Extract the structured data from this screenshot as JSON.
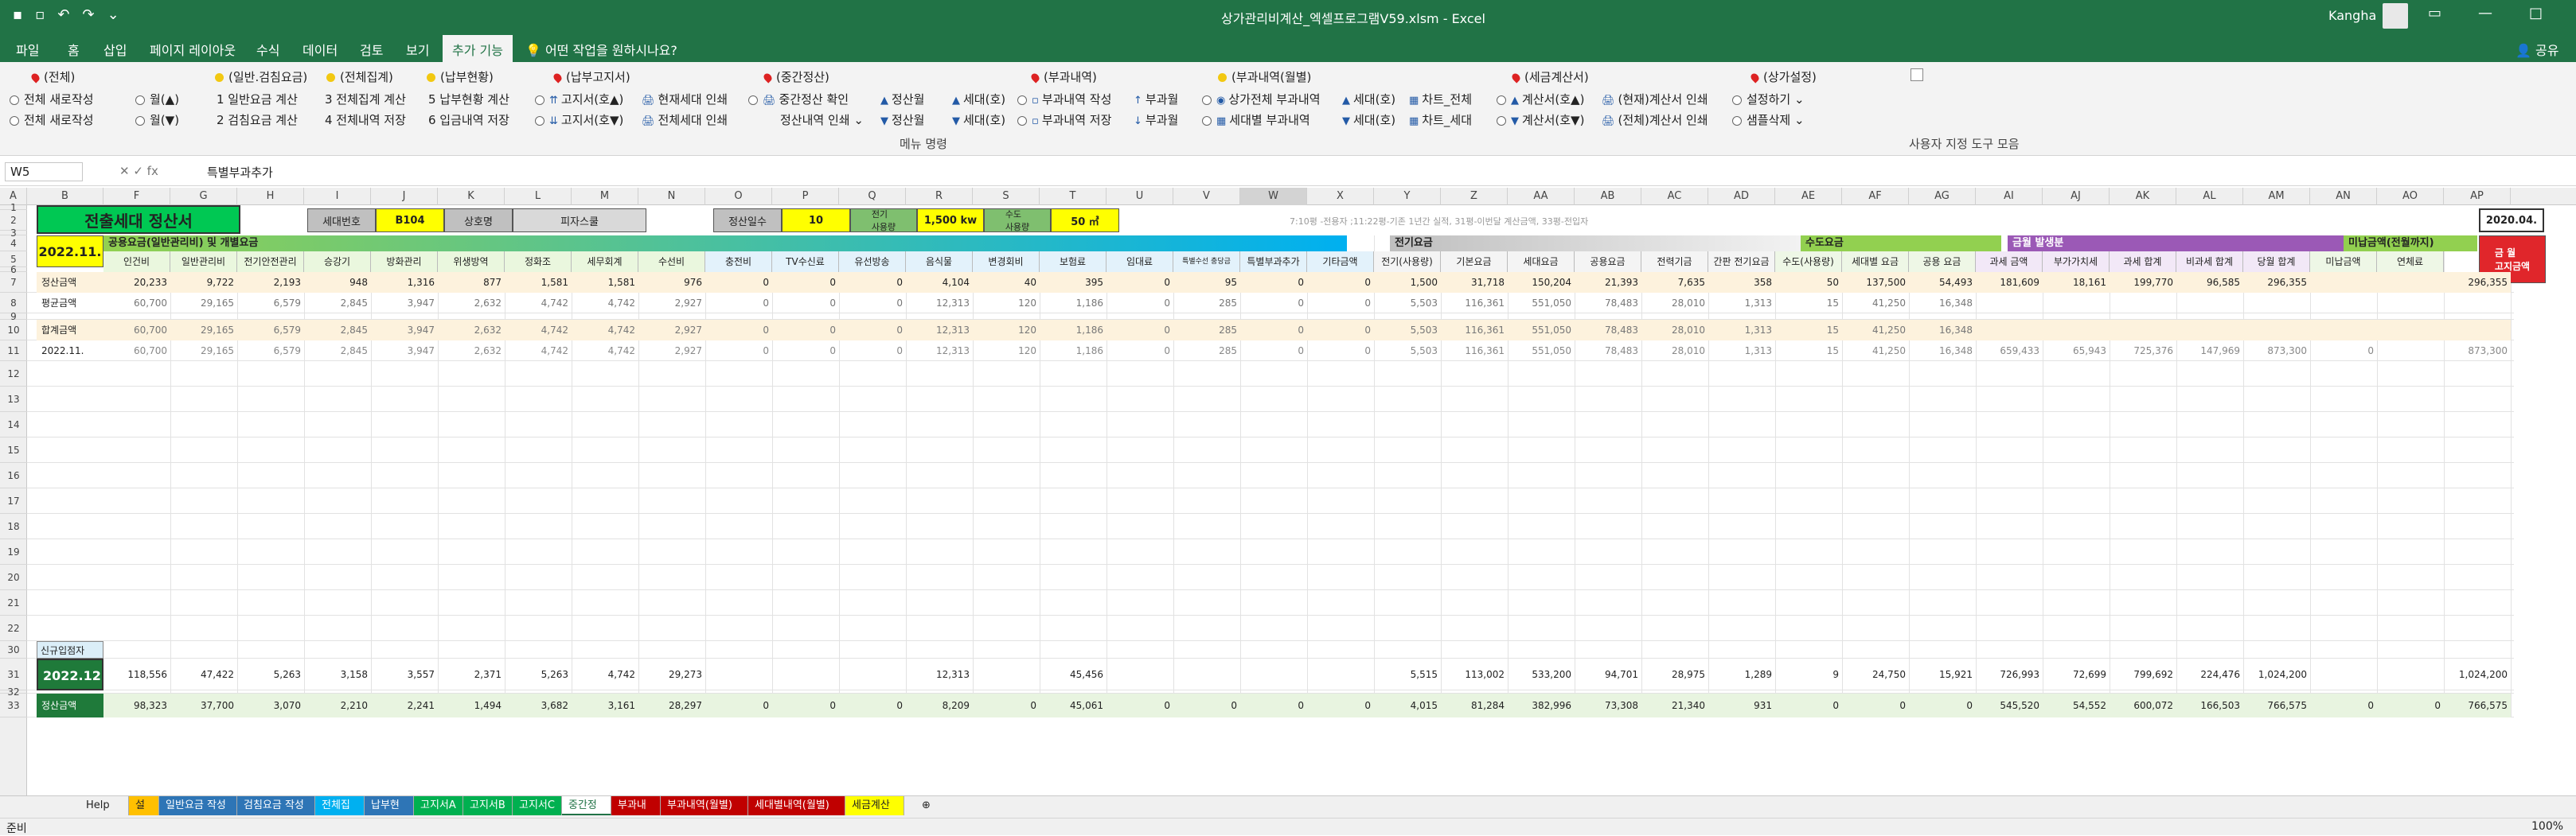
{
  "titlebar": {
    "title": "상가관리비계산_엑셀프로그램V59.xlsm  -  Excel",
    "user": "Kangha"
  },
  "tabs": [
    "파일",
    "홈",
    "삽입",
    "페이지 레이아웃",
    "수식",
    "데이터",
    "검토",
    "보기",
    "추가 기능"
  ],
  "active_tab": "추가 기능",
  "tell_me": "어떤 작업을 원하시나요?",
  "share": "공유",
  "ribbon": {
    "headers": [
      "(전체)",
      "(일반.검침요금)",
      "(전체집계)",
      "(납부현황)",
      "(납부고지서)",
      "(중간정산)",
      "(부과내역)",
      "(부과내역(월별)",
      "(세금계산서)",
      "(상가설정)"
    ],
    "row1": [
      "전체 새로작성",
      "월(▲)",
      "1 일반요금 계산",
      "3 전체집계 계산",
      "5 납부현황 계산",
      "고지서(호▲)",
      "현재세대 인쇄",
      "중간정산 확인",
      "정산월",
      "세대(호)",
      "부과내역 작성",
      "부과월",
      "상가전체 부과내역",
      "세대(호)",
      "차트_전체",
      "계산서(호▲)",
      "(현재)계산서 인쇄",
      "설정하기"
    ],
    "row2": [
      "전체 새로작성",
      "월(▼)",
      "2 검침요금 계산",
      "4 전체내역 저장",
      "6 입금내역 저장",
      "고지서(호▼)",
      "전체세대 인쇄",
      "정산내역 인쇄",
      "정산월",
      "세대(호)",
      "부과내역 저장",
      "부과월",
      "세대별 부과내역",
      "세대(호)",
      "차트_세대",
      "계산서(호▼)",
      "(전체)계산서 인쇄",
      "샘플삭제"
    ],
    "group_label": "메뉴 명령",
    "custom_label": "사용자 지정 도구 모음"
  },
  "namebox": "W5",
  "formula": "특별부과추가",
  "columns": [
    "A",
    "B",
    "F",
    "G",
    "H",
    "I",
    "J",
    "K",
    "L",
    "M",
    "N",
    "O",
    "P",
    "Q",
    "R",
    "S",
    "T",
    "U",
    "V",
    "W",
    "X",
    "Y",
    "Z",
    "AA",
    "AB",
    "AC",
    "AD",
    "AE",
    "AF",
    "AG",
    "AI",
    "AJ",
    "AK",
    "AL",
    "AM",
    "AN",
    "AO",
    "AP"
  ],
  "selected_column": "W",
  "rows": [
    "1",
    "2",
    "3",
    "4",
    "5",
    "6",
    "7",
    "8",
    "9",
    "10",
    "11",
    "12",
    "13",
    "14",
    "15",
    "16",
    "17",
    "18",
    "19",
    "20",
    "21",
    "22",
    "30",
    "31",
    "32",
    "33"
  ],
  "title_box": "전출세대 정산서",
  "info": {
    "unit_label": "세대번호",
    "unit": "B104",
    "name_label": "상호명",
    "name": "피자스쿨",
    "days_label": "정산일수",
    "days": "10",
    "elec_label": "전기\n사용량",
    "elec": "1,500 kw",
    "water_label": "수도\n사용량",
    "water": "50 ㎥",
    "note": "7:10평 -전용자 ;11:22평-기존 1년간 실적, 31평-이번달 계산금액, 33평-전입자",
    "date": "2020.04."
  },
  "month_label": "2022.11.",
  "sections": {
    "common": "공용요금(일반관리비) 및 개별요금",
    "elec": "전기요금",
    "water": "수도요금",
    "billing": "금월 발생분",
    "unpaid": "미납금액(전월까지)",
    "notice": "금 월\n고지금액"
  },
  "headers": [
    "인건비",
    "일반관리비",
    "전기안전관리",
    "승강기",
    "방화관리",
    "위생방역",
    "정화조",
    "세무회계",
    "수선비",
    "충전비",
    "TV수신료",
    "유선방송",
    "음식물",
    "변경회비",
    "보험료",
    "임대료",
    "특별수선 충당금",
    "특별부과추가",
    "기타금액",
    "전기(사용량)",
    "기본요금",
    "세대요금",
    "공용요금",
    "전력기금",
    "간판 전기요금",
    "수도(사용량)",
    "세대별 요금",
    "공용 요금",
    "과세 금액",
    "부가가치세",
    "과세 합계",
    "비과세 합계",
    "당월 합계",
    "미납금액",
    "연체료",
    ""
  ],
  "row_labels": {
    "r7": "정산금액",
    "r8": "평균금액",
    "r10": "합계금액",
    "r11": "2022.11.",
    "r30": "신규입점자",
    "r31": "2022.12.",
    "r33": "정산금액"
  },
  "data": {
    "r7": [
      "20,233",
      "9,722",
      "2,193",
      "948",
      "1,316",
      "877",
      "1,581",
      "1,581",
      "976",
      "0",
      "0",
      "0",
      "4,104",
      "40",
      "395",
      "0",
      "95",
      "0",
      "0",
      "1,500",
      "31,718",
      "150,204",
      "21,393",
      "7,635",
      "358",
      "50",
      "137,500",
      "54,493",
      "181,609",
      "18,161",
      "199,770",
      "96,585",
      "296,355",
      "",
      "",
      "296,355"
    ],
    "r8": [
      "60,700",
      "29,165",
      "6,579",
      "2,845",
      "3,947",
      "2,632",
      "4,742",
      "4,742",
      "2,927",
      "0",
      "0",
      "0",
      "12,313",
      "120",
      "1,186",
      "0",
      "285",
      "0",
      "0",
      "5,503",
      "116,361",
      "551,050",
      "78,483",
      "28,010",
      "1,313",
      "15",
      "41,250",
      "16,348",
      "",
      "",
      "",
      "",
      "",
      "",
      "",
      ""
    ],
    "r10": [
      "60,700",
      "29,165",
      "6,579",
      "2,845",
      "3,947",
      "2,632",
      "4,742",
      "4,742",
      "2,927",
      "0",
      "0",
      "0",
      "12,313",
      "120",
      "1,186",
      "0",
      "285",
      "0",
      "0",
      "5,503",
      "116,361",
      "551,050",
      "78,483",
      "28,010",
      "1,313",
      "15",
      "41,250",
      "16,348",
      "",
      "",
      "",
      "",
      "",
      "",
      "",
      ""
    ],
    "r11": [
      "60,700",
      "29,165",
      "6,579",
      "2,845",
      "3,947",
      "2,632",
      "4,742",
      "4,742",
      "2,927",
      "0",
      "0",
      "0",
      "12,313",
      "120",
      "1,186",
      "0",
      "285",
      "0",
      "0",
      "5,503",
      "116,361",
      "551,050",
      "78,483",
      "28,010",
      "1,313",
      "15",
      "41,250",
      "16,348",
      "659,433",
      "65,943",
      "725,376",
      "147,969",
      "873,300",
      "0",
      "",
      "873,300"
    ],
    "r31": [
      "118,556",
      "47,422",
      "5,263",
      "3,158",
      "3,557",
      "2,371",
      "5,263",
      "4,742",
      "29,273",
      "",
      "",
      "",
      "12,313",
      "",
      "45,456",
      "",
      "",
      "",
      "",
      "5,515",
      "113,002",
      "533,200",
      "94,701",
      "28,975",
      "1,289",
      "9",
      "24,750",
      "15,921",
      "726,993",
      "72,699",
      "799,692",
      "224,476",
      "1,024,200",
      "",
      "",
      "1,024,200"
    ],
    "r33": [
      "98,323",
      "37,700",
      "3,070",
      "2,210",
      "2,241",
      "1,494",
      "3,682",
      "3,161",
      "28,297",
      "0",
      "0",
      "0",
      "8,209",
      "0",
      "45,061",
      "0",
      "0",
      "0",
      "0",
      "4,015",
      "81,284",
      "382,996",
      "73,308",
      "21,340",
      "931",
      "0",
      "0",
      "0",
      "545,520",
      "54,552",
      "600,072",
      "166,503",
      "766,575",
      "0",
      "0",
      "766,575"
    ]
  },
  "sheet_tabs": [
    "Help",
    "설정",
    "일반요금 작성",
    "검침요금 작성",
    "전체집계",
    "납부현황",
    "고지서A",
    "고지서B",
    "고지서C",
    "중간정산",
    "부과내역",
    "부과내역(월별)",
    "세대별내역(월별)",
    "세금계산서"
  ],
  "active_sheet": "중간정산",
  "status": "준비",
  "zoom": "100%"
}
